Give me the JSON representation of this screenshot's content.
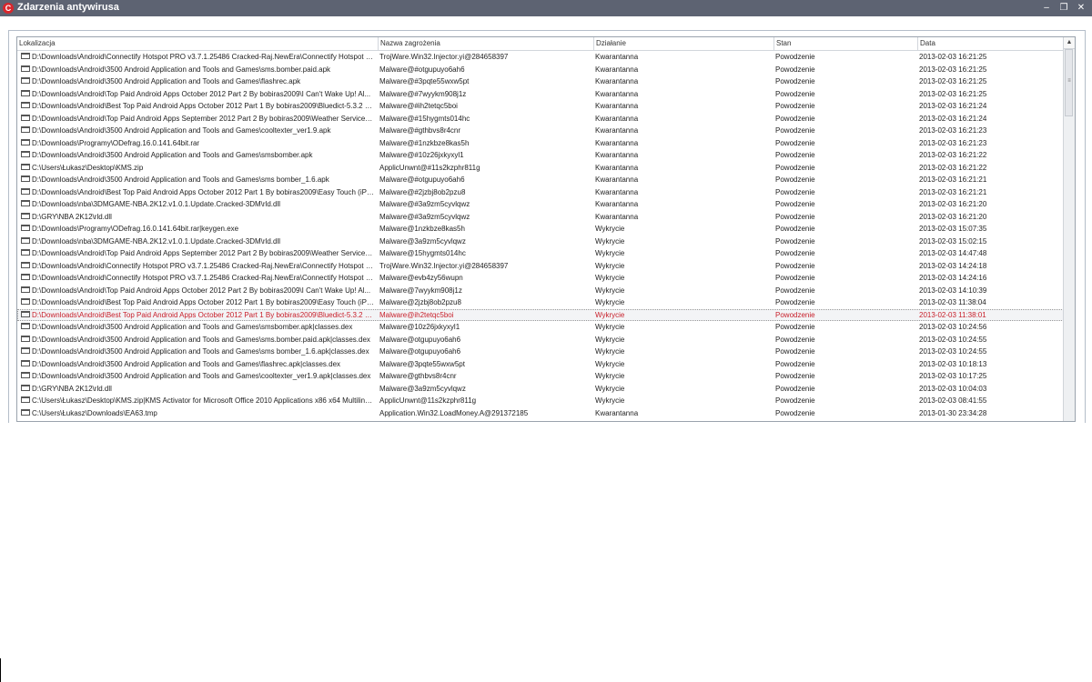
{
  "window": {
    "title": "Zdarzenia antywirusa",
    "app_icon": "C",
    "buttons": {
      "minimize": "–",
      "restore": "❐",
      "close": "✕"
    }
  },
  "table": {
    "columns": [
      "Lokalizacja",
      "Nazwa zagrożenia",
      "Działanie",
      "Stan",
      "Data"
    ],
    "rows": [
      [
        "D:\\Downloads\\Android\\Connectify Hotspot PRO v3.7.1.25486 Cracked-Raj.NewEra\\Connectify Hotspot PR...",
        "TrojWare.Win32.Injector.yi@284658397",
        "Kwarantanna",
        "Powodzenie",
        "2013-02-03 16:21:25"
      ],
      [
        "D:\\Downloads\\Android\\3500 Android Application and Tools and Games\\sms.bomber.paid.apk",
        "Malware@#otgupuyo6ah6",
        "Kwarantanna",
        "Powodzenie",
        "2013-02-03 16:21:25"
      ],
      [
        "D:\\Downloads\\Android\\3500 Android Application and Tools and Games\\flashrec.apk",
        "Malware@#3pqte55wxw5pt",
        "Kwarantanna",
        "Powodzenie",
        "2013-02-03 16:21:25"
      ],
      [
        "D:\\Downloads\\Android\\Top Paid Android Apps October 2012 Part 2 By bobiras2009\\I Can't Wake Up! Al...",
        "Malware@#7wyykm908j1z",
        "Kwarantanna",
        "Powodzenie",
        "2013-02-03 16:21:25"
      ],
      [
        "D:\\Downloads\\Android\\Best Top Paid Android Apps October 2012 Part 1 By bobiras2009\\Bluedict-5.3.2 Final...",
        "Malware@#ih2tetqc5boi",
        "Kwarantanna",
        "Powodzenie",
        "2013-02-03 16:21:24"
      ],
      [
        "D:\\Downloads\\Android\\Top Paid Android Apps September 2012 Part 2 By bobiras2009\\Weather Services PR...",
        "Malware@#15hygmts014hc",
        "Kwarantanna",
        "Powodzenie",
        "2013-02-03 16:21:24"
      ],
      [
        "D:\\Downloads\\Android\\3500 Android Application and Tools and Games\\cooltexter_ver1.9.apk",
        "Malware@#gthbvs8r4cnr",
        "Kwarantanna",
        "Powodzenie",
        "2013-02-03 16:21:23"
      ],
      [
        "D:\\Downloads\\Programy\\ODefrag.16.0.141.64bit.rar",
        "Malware@#1nzkbze8kas5h",
        "Kwarantanna",
        "Powodzenie",
        "2013-02-03 16:21:23"
      ],
      [
        "D:\\Downloads\\Android\\3500 Android Application and Tools and Games\\smsbomber.apk",
        "Malware@#10z26jxkyxyl1",
        "Kwarantanna",
        "Powodzenie",
        "2013-02-03 16:21:22"
      ],
      [
        "C:\\Users\\Łukasz\\Desktop\\KMS.zip",
        "ApplicUnwnt@#11s2kzphr811g",
        "Kwarantanna",
        "Powodzenie",
        "2013-02-03 16:21:22"
      ],
      [
        "D:\\Downloads\\Android\\3500 Android Application and Tools and Games\\sms bomber_1.6.apk",
        "Malware@#otgupuyo6ah6",
        "Kwarantanna",
        "Powodzenie",
        "2013-02-03 16:21:21"
      ],
      [
        "D:\\Downloads\\Android\\Best Top Paid Android Apps October 2012 Part 1 By bobiras2009\\Easy Touch (iPhone...",
        "Malware@#2jzbj8ob2pzu8",
        "Kwarantanna",
        "Powodzenie",
        "2013-02-03 16:21:21"
      ],
      [
        "D:\\Downloads\\nba\\3DMGAME-NBA.2K12.v1.0.1.Update.Cracked-3DM\\rld.dll",
        "Malware@#3a9zm5cyvlqwz",
        "Kwarantanna",
        "Powodzenie",
        "2013-02-03 16:21:20"
      ],
      [
        "D:\\GRY\\NBA 2K12\\rld.dll",
        "Malware@#3a9zm5cyvlqwz",
        "Kwarantanna",
        "Powodzenie",
        "2013-02-03 16:21:20"
      ],
      [
        "D:\\Downloads\\Programy\\ODefrag.16.0.141.64bit.rar|keygen.exe",
        "Malware@1nzkbze8kas5h",
        "Wykrycie",
        "Powodzenie",
        "2013-02-03 15:07:35"
      ],
      [
        "D:\\Downloads\\nba\\3DMGAME-NBA.2K12.v1.0.1.Update.Cracked-3DM\\rld.dll",
        "Malware@3a9zm5cyvlqwz",
        "Wykrycie",
        "Powodzenie",
        "2013-02-03 15:02:15"
      ],
      [
        "D:\\Downloads\\Android\\Top Paid Android Apps September 2012 Part 2 By bobiras2009\\Weather Services PR...",
        "Malware@15hygmts014hc",
        "Wykrycie",
        "Powodzenie",
        "2013-02-03 14:47:48"
      ],
      [
        "D:\\Downloads\\Android\\Connectify Hotspot PRO v3.7.1.25486 Cracked-Raj.NewEra\\Connectify Hotspot PR...",
        "TrojWare.Win32.Injector.yi@284658397",
        "Wykrycie",
        "Powodzenie",
        "2013-02-03 14:24:18"
      ],
      [
        "D:\\Downloads\\Android\\Connectify Hotspot PRO v3.7.1.25486 Cracked-Raj.NewEra\\Connectify Hotspot PR...",
        "Malware@evb4zy56wupn",
        "Wykrycie",
        "Powodzenie",
        "2013-02-03 14:24:16"
      ],
      [
        "D:\\Downloads\\Android\\Top Paid Android Apps October 2012 Part 2 By bobiras2009\\I Can't Wake Up! Al...",
        "Malware@7wyykm908j1z",
        "Wykrycie",
        "Powodzenie",
        "2013-02-03 14:10:39"
      ],
      [
        "D:\\Downloads\\Android\\Best Top Paid Android Apps October 2012 Part 1 By bobiras2009\\Easy Touch (iPhone...",
        "Malware@2jzbj8ob2pzu8",
        "Wykrycie",
        "Powodzenie",
        "2013-02-03 11:38:04"
      ],
      [
        "D:\\Downloads\\Android\\Best Top Paid Android Apps October 2012 Part 1 By bobiras2009\\Bluedict-5.3.2 Final...",
        "Malware@ih2tetqc5boi",
        "Wykrycie",
        "Powodzenie",
        "2013-02-03 11:38:01"
      ],
      [
        "D:\\Downloads\\Android\\3500 Android Application and Tools and Games\\smsbomber.apk|classes.dex",
        "Malware@10z26jxkyxyl1",
        "Wykrycie",
        "Powodzenie",
        "2013-02-03 10:24:56"
      ],
      [
        "D:\\Downloads\\Android\\3500 Android Application and Tools and Games\\sms.bomber.paid.apk|classes.dex",
        "Malware@otgupuyo6ah6",
        "Wykrycie",
        "Powodzenie",
        "2013-02-03 10:24:55"
      ],
      [
        "D:\\Downloads\\Android\\3500 Android Application and Tools and Games\\sms bomber_1.6.apk|classes.dex",
        "Malware@otgupuyo6ah6",
        "Wykrycie",
        "Powodzenie",
        "2013-02-03 10:24:55"
      ],
      [
        "D:\\Downloads\\Android\\3500 Android Application and Tools and Games\\flashrec.apk|classes.dex",
        "Malware@3pqte55wxw5pt",
        "Wykrycie",
        "Powodzenie",
        "2013-02-03 10:18:13"
      ],
      [
        "D:\\Downloads\\Android\\3500 Android Application and Tools and Games\\cooltexter_ver1.9.apk|classes.dex",
        "Malware@gthbvs8r4cnr",
        "Wykrycie",
        "Powodzenie",
        "2013-02-03 10:17:25"
      ],
      [
        "D:\\GRY\\NBA 2K12\\rld.dll",
        "Malware@3a9zm5cyvlqwz",
        "Wykrycie",
        "Powodzenie",
        "2013-02-03 10:04:03"
      ],
      [
        "C:\\Users\\Łukasz\\Desktop\\KMS.zip|KMS Activator for Microsoft Office 2010 Applications x86 x64 Multilingual-...",
        "ApplicUnwnt@11s2kzphr811g",
        "Wykrycie",
        "Powodzenie",
        "2013-02-03 08:41:55"
      ],
      [
        "C:\\Users\\Łukasz\\Downloads\\EA63.tmp",
        "Application.Win32.LoadMoney.A@291372185",
        "Kwarantanna",
        "Powodzenie",
        "2013-01-30 23:34:28"
      ]
    ],
    "selected_row": 21
  },
  "icons": {
    "file": "file-icon",
    "scroll_up": "▲",
    "scroll_grip": "≡"
  },
  "colors": {
    "titlebar": "#5d6372",
    "app_icon": "#d8262c",
    "selected_text": "#c8202b"
  }
}
